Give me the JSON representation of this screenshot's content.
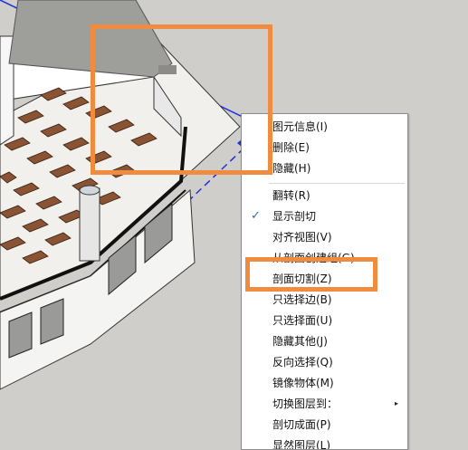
{
  "context_menu": {
    "items": [
      {
        "label": "图元信息(I)",
        "checked": false,
        "submenu": false
      },
      {
        "label": "删除(E)",
        "checked": false,
        "submenu": false
      },
      {
        "label": "隐藏(H)",
        "checked": false,
        "submenu": false
      },
      {
        "label": "翻转(R)",
        "checked": false,
        "submenu": false
      },
      {
        "label": "显示剖切",
        "checked": true,
        "submenu": false
      },
      {
        "label": "对齐视图(V)",
        "checked": false,
        "submenu": false
      },
      {
        "label": "从剖面创建组(G)",
        "checked": false,
        "submenu": false
      },
      {
        "label": "剖面切割(Z)",
        "checked": false,
        "submenu": false
      },
      {
        "label": "只选择边(B)",
        "checked": false,
        "submenu": false
      },
      {
        "label": "只选择面(U)",
        "checked": false,
        "submenu": false
      },
      {
        "label": "隐藏其他(J)",
        "checked": false,
        "submenu": false
      },
      {
        "label": "反向选择(Q)",
        "checked": false,
        "submenu": false
      },
      {
        "label": "镜像物体(M)",
        "checked": false,
        "submenu": false
      },
      {
        "label": "切换图层到：",
        "checked": false,
        "submenu": true
      },
      {
        "label": "剖切成面(P)",
        "checked": false,
        "submenu": false
      },
      {
        "label": "显然图层(L)",
        "checked": false,
        "submenu": false
      }
    ],
    "check_glyph": "✓",
    "submenu_glyph": "▸"
  },
  "highlight_color": "#ef8c40",
  "section_plane_color": "#1f2fe0"
}
